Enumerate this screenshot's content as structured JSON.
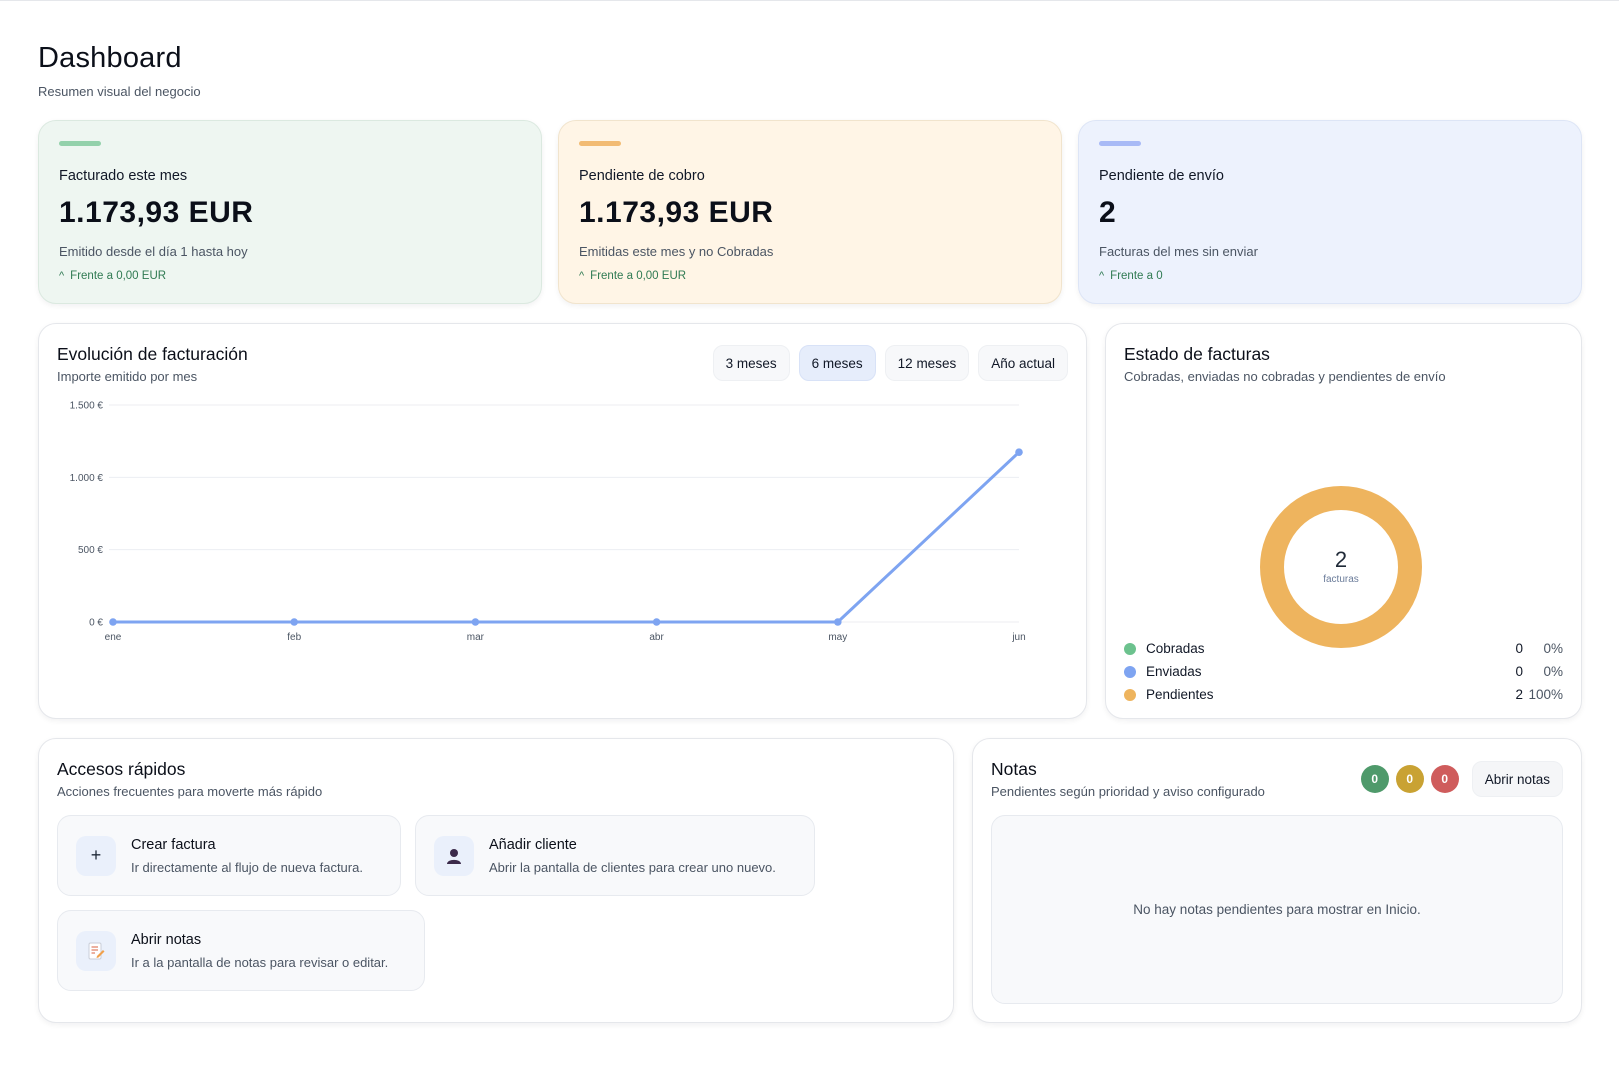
{
  "page": {
    "title": "Dashboard",
    "subtitle": "Resumen visual del negocio"
  },
  "kpis": [
    {
      "label": "Facturado este mes",
      "value": "1.173,93 EUR",
      "description": "Emitido desde el día 1 hasta hoy",
      "trend": "Frente a 0,00 EUR",
      "accent": "#93d1ab"
    },
    {
      "label": "Pendiente de cobro",
      "value": "1.173,93 EUR",
      "description": "Emitidas este mes y no Cobradas",
      "trend": "Frente a 0,00 EUR",
      "accent": "#f2bb73"
    },
    {
      "label": "Pendiente de envío",
      "value": "2",
      "description": "Facturas del mes sin enviar",
      "trend": "Frente a 0",
      "accent": "#a8baf6"
    }
  ],
  "billing_chart": {
    "title": "Evolución de facturación",
    "subtitle": "Importe emitido por mes",
    "ranges": [
      {
        "label": "3 meses",
        "active": false
      },
      {
        "label": "6 meses",
        "active": true
      },
      {
        "label": "12 meses",
        "active": false
      },
      {
        "label": "Año actual",
        "active": false
      }
    ]
  },
  "chart_data": [
    {
      "type": "line",
      "title": "Evolución de facturación",
      "categories": [
        "ene",
        "feb",
        "mar",
        "abr",
        "may",
        "jun"
      ],
      "series": [
        {
          "values": [
            0,
            0,
            0,
            0,
            0,
            1173.93
          ],
          "color": "#7ea4f1"
        }
      ],
      "ylim": [
        0,
        1500
      ],
      "yticks": [
        0,
        500,
        1000,
        1500
      ],
      "ytick_labels": [
        "0 €",
        "500 €",
        "1.000 €",
        "1.500 €"
      ],
      "grid": true
    },
    {
      "type": "pie",
      "title": "Estado de facturas",
      "labels": [
        "Cobradas",
        "Enviadas",
        "Pendientes"
      ],
      "values": [
        0,
        0,
        2
      ],
      "colors": [
        "#6cc28e",
        "#7ea4f1",
        "#eeb45e"
      ]
    }
  ],
  "invoice_status": {
    "title": "Estado de facturas",
    "subtitle": "Cobradas, enviadas no cobradas y pendientes de envío",
    "total": "2",
    "total_label": "facturas",
    "items": [
      {
        "name": "Cobradas",
        "count": "0",
        "pct": "0%",
        "color": "#6cc28e"
      },
      {
        "name": "Enviadas",
        "count": "0",
        "pct": "0%",
        "color": "#7ea4f1"
      },
      {
        "name": "Pendientes",
        "count": "2",
        "pct": "100%",
        "color": "#eeb45e"
      }
    ]
  },
  "quick_access": {
    "title": "Accesos rápidos",
    "subtitle": "Acciones frecuentes para moverte más rápido",
    "items": [
      {
        "title": "Crear factura",
        "description": "Ir directamente al flujo de nueva factura.",
        "icon": "plus-icon",
        "glyph": "+"
      },
      {
        "title": "Añadir cliente",
        "description": "Abrir la pantalla de clientes para crear uno nuevo.",
        "icon": "user-icon"
      },
      {
        "title": "Abrir notas",
        "description": "Ir a la pantalla de notas para revisar o editar.",
        "icon": "notepad-icon"
      }
    ]
  },
  "notes": {
    "title": "Notas",
    "subtitle": "Pendientes según prioridad y aviso configurado",
    "counts": [
      {
        "value": "0",
        "color": "#4f9a6b"
      },
      {
        "value": "0",
        "color": "#c9a233"
      },
      {
        "value": "0",
        "color": "#cf5c5c"
      }
    ],
    "open_label": "Abrir notas",
    "empty_message": "No hay notas pendientes para mostrar en Inicio."
  }
}
